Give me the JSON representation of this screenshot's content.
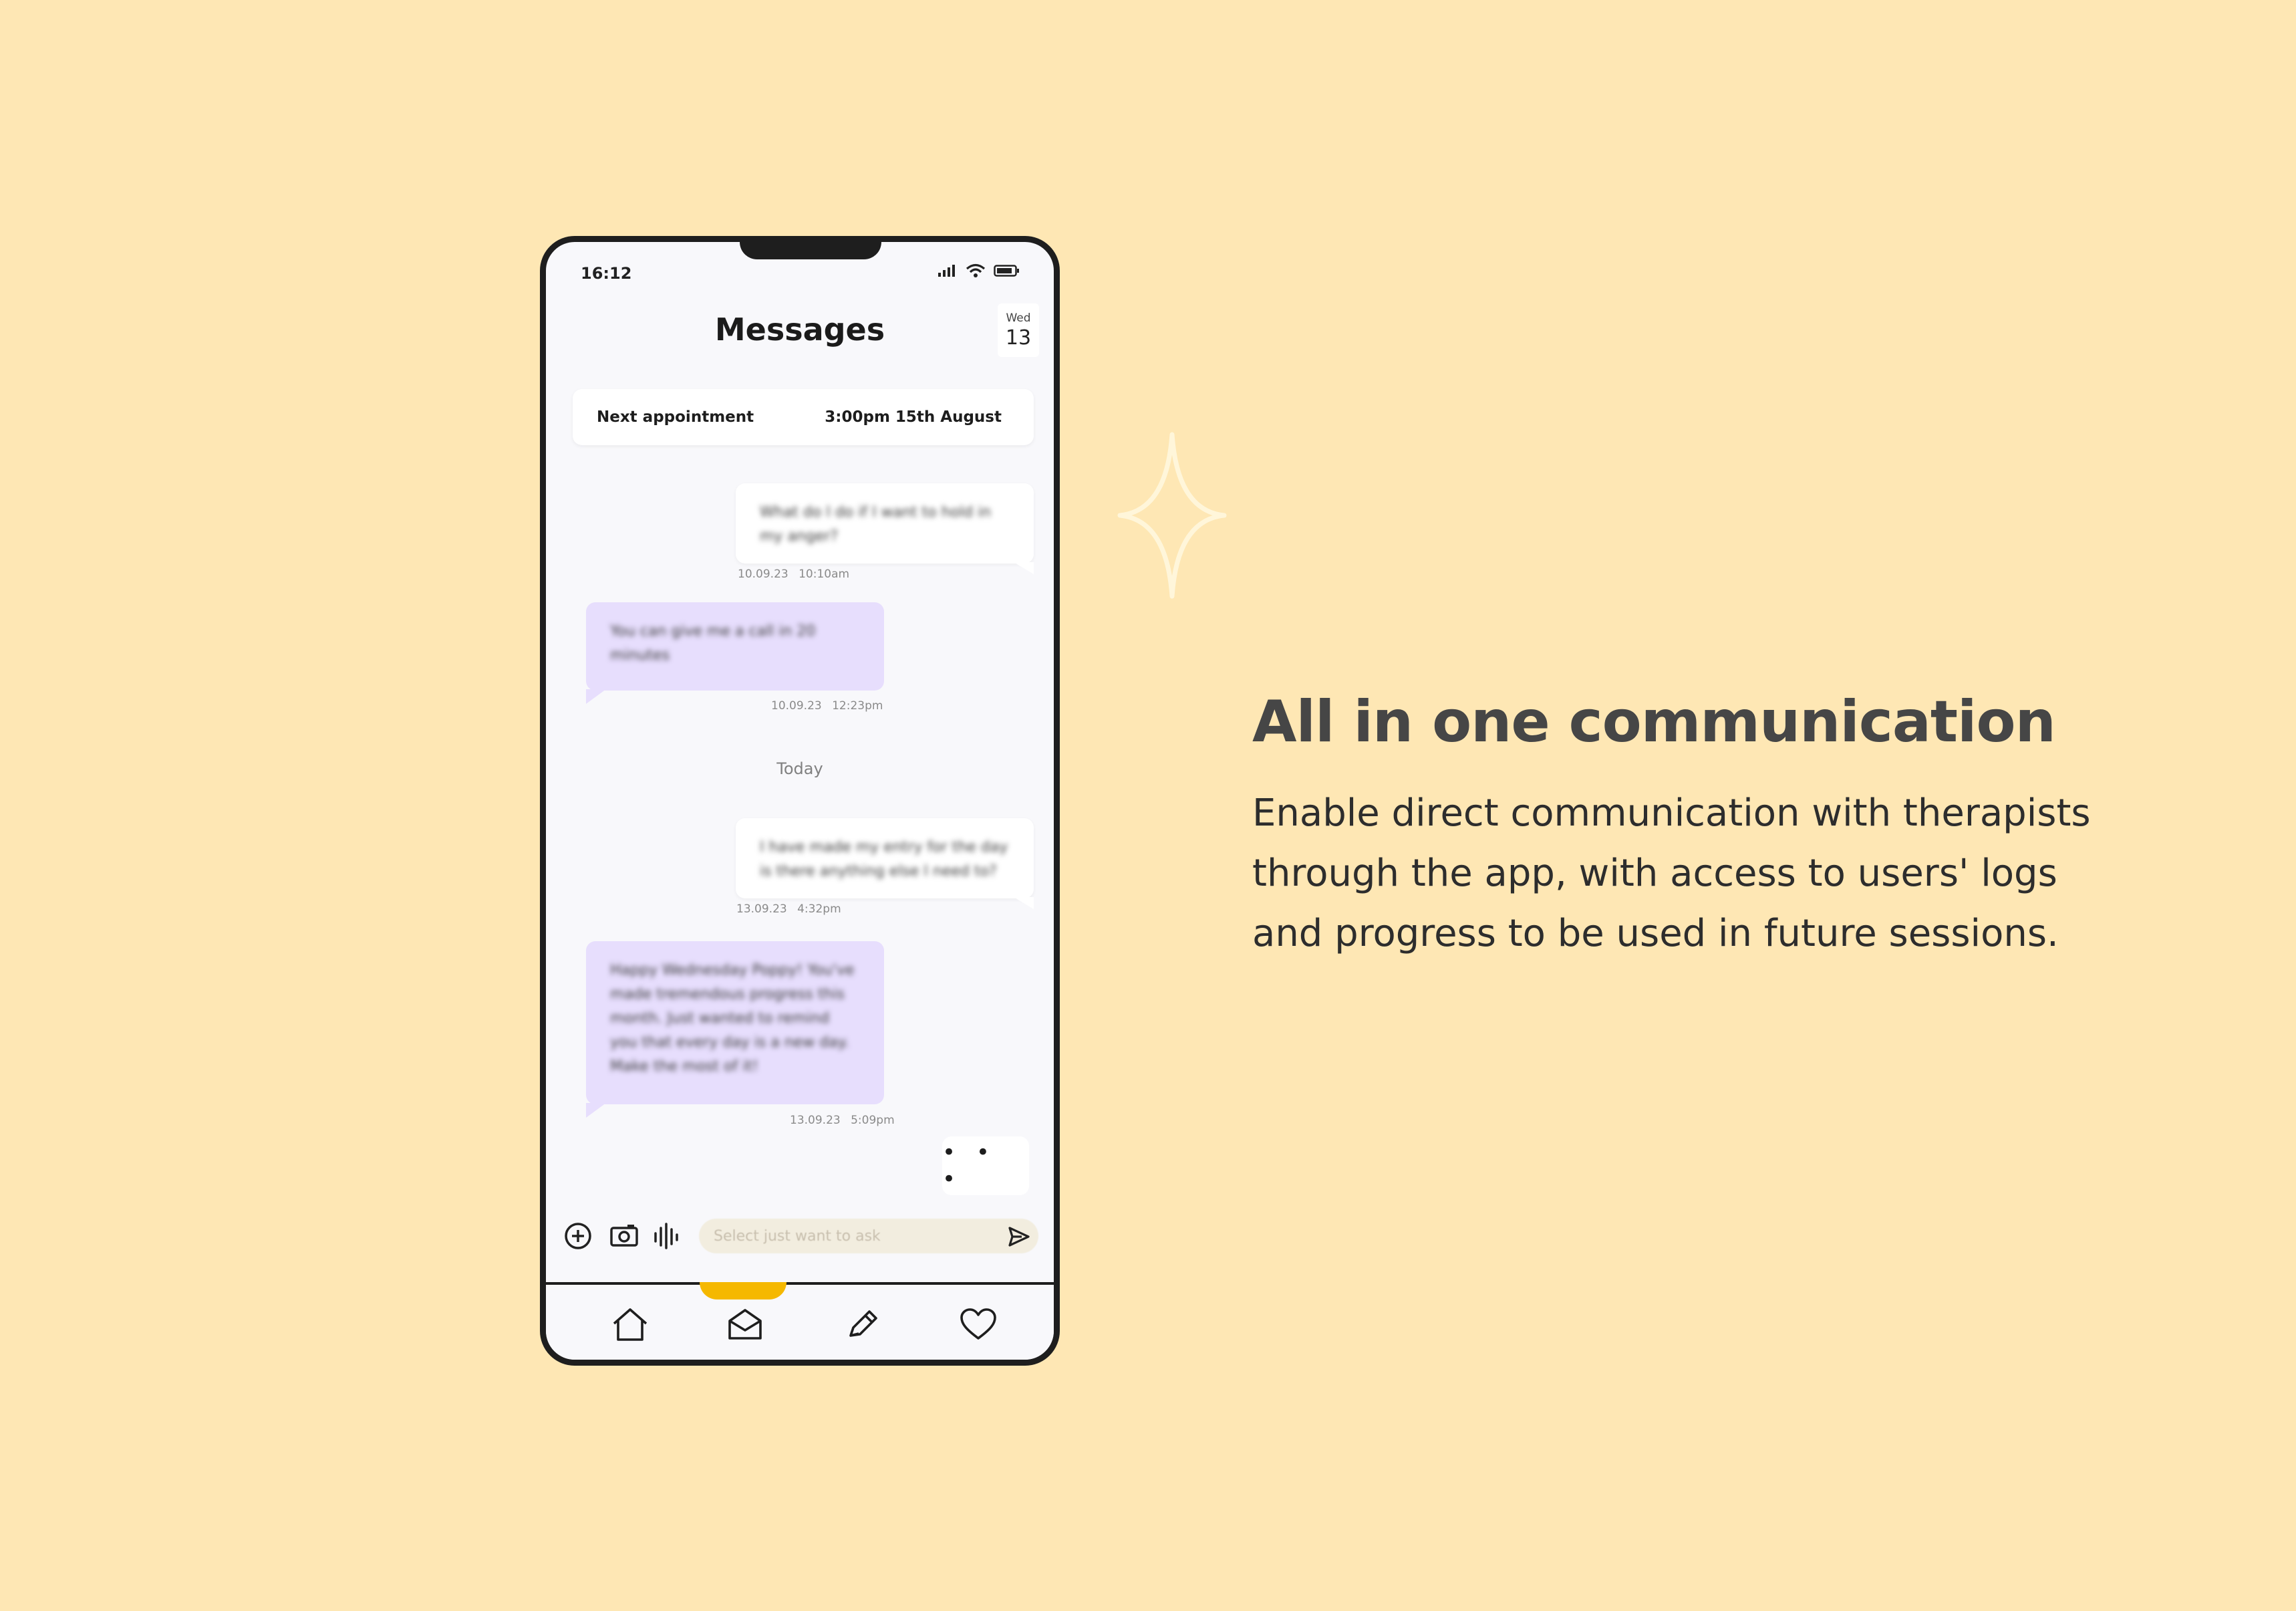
{
  "status": {
    "time": "16:12"
  },
  "header": {
    "title": "Messages",
    "date_dow": "Wed",
    "date_day": "13"
  },
  "appointment": {
    "label": "Next appointment",
    "value": "3:00pm 15th August"
  },
  "messages": [
    {
      "text": "What do I do if I want to hold in my anger?",
      "timestamp": "10.09.23 10:10am"
    },
    {
      "text": "You can give me a call in 20 minutes",
      "timestamp": "10.09.23 12:23pm"
    },
    {
      "text": "I have made my entry for the day is there anything else I need to?",
      "timestamp": "13.09.23 4:32pm"
    },
    {
      "text": "Happy Wednesday Poppy! You've made tremendous progress this month. Just wanted to remind you that every day is a new day. Make the most of it!",
      "timestamp": "13.09.23 5:09pm"
    }
  ],
  "divider": {
    "today": "Today"
  },
  "typing": {
    "indicator": "• • •"
  },
  "composer": {
    "placeholder": "Select just want to ask"
  },
  "promo": {
    "heading": "All in one communication",
    "body": "Enable direct communication with therapists through the app, with access to users' logs and progress to be used in future sessions."
  },
  "colors": {
    "background": "#FEE7B4",
    "received_bubble": "#E7DEFD",
    "accent": "#F5B800"
  },
  "nav": {
    "active": "messages-tab",
    "items": [
      "home-icon",
      "envelope-open-icon",
      "pencil-icon",
      "heart-icon"
    ]
  }
}
